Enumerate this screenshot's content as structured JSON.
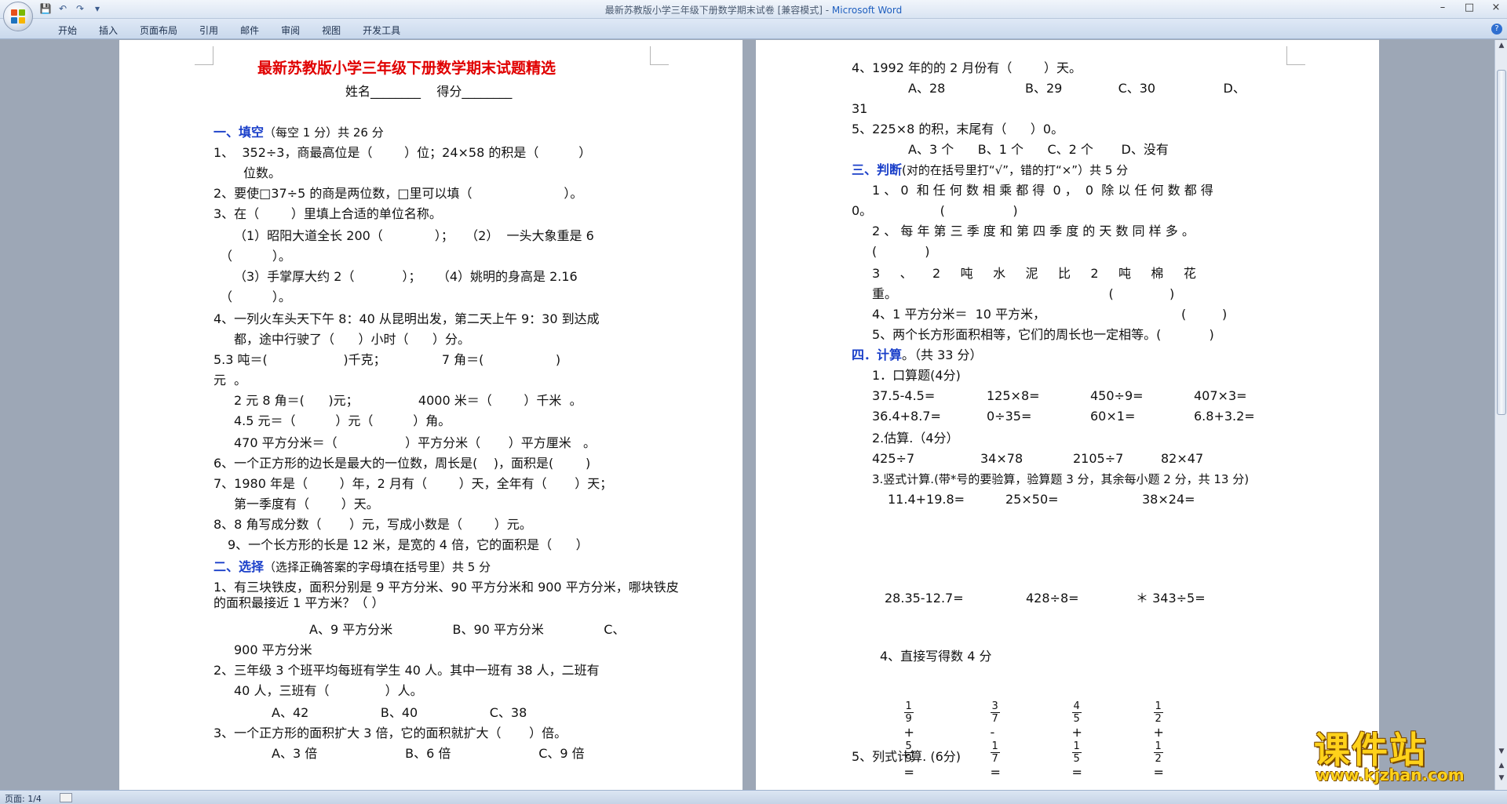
{
  "window": {
    "title": "最新苏教版小学三年级下册数学期末试卷 [兼容模式] - ",
    "app_name": "Microsoft Word",
    "controls": [
      "–",
      "□",
      "×"
    ]
  },
  "ribbon": {
    "tabs": [
      "开始",
      "插入",
      "页面布局",
      "引用",
      "邮件",
      "审阅",
      "视图",
      "开发工具"
    ]
  },
  "status": {
    "page": "页面: 1/4"
  },
  "watermark": {
    "name": "课件站",
    "url": "www.kjzhan.com"
  },
  "page1": {
    "title": "最新苏教版小学三年级下册数学期末试题精选",
    "lines": [
      "姓名________    得分________",
      "一、填空",
      "（每空 1 分）共 26 分",
      "1、  352÷3，商最高位是（        ）位；24×58 的积是（          ）",
      "位数。",
      "2、要使□37÷5 的商是两位数，□里可以填（                       ）。",
      "3、在（        ）里填上合适的单位名称。",
      "（1）昭阳大道全长 200（             ）；   （2）  一头大象重是 6",
      "（          ）。",
      "（3）手掌厚大约 2（            ）；    （4）姚明的身高是 2.16",
      "（          ）。",
      "4、一列火车头天下午 8：40 从昆明出发，第二天上午 9：30 到达成",
      "都，途中行驶了（      ）小时（      ）分。",
      "5.3 吨＝(                   )千克；              7 角＝(                  )",
      "元  。",
      "2 元 8 角＝(      )元；               4000 米＝（        ）千米  。",
      "4.5 元＝（          ）元（          ）角。",
      "470 平方分米＝（                 ）平方分米（       ）平方厘米   。",
      "6、一个正方形的边长是最大的一位数，周长是(    )，面积是(        )",
      "7、1980 年是（        ）年，2 月有（        ）天，全年有（       ）天；",
      "第一季度有（        ）天。",
      "8、8 角写成分数（       ）元，写成小数是（        ）元。",
      "9、一个长方形的长是 12 米，是宽的 4 倍，它的面积是（      ）",
      "二、选择",
      "（选择正确答案的字母填在括号里）共 5 分",
      "1、有三块铁皮，面积分别是 9 平方分米、90 平方分米和 900 平方分米，哪块铁皮的面积最接近 1 平方米？（               ）",
      "A、9 平方分米               B、90 平方分米               C、",
      "900 平方分米",
      "2、三年级 3 个班平均每班有学生 40 人。其中一班有 38 人，二班有",
      "40 人，三班有（              ）人。",
      "A、42                  B、40                  C、38",
      "3、一个正方形的面积扩大 3 倍，它的面积就扩大（       ）倍。",
      "A、3 倍                      B、6 倍                      C、9 倍"
    ]
  },
  "page2": {
    "lines": [
      "4、1992 年的的 2 月份有（        ）天。",
      "A、28                    B、29              C、30                 D、",
      "31",
      "5、225×8 的积，末尾有（      ）0。",
      "A、3 个      B、1 个      C、2 个       D、没有",
      "三、判断",
      "(对的在括号里打“√”，错的打“×”）共 5 分",
      "1 、 0  和 任 何 数 相 乘 都 得  0 ，  0  除 以 任 何 数 都 得",
      "0。                 (                 )",
      "2 、 每 年 第 三 季 度 和 第 四 季 度 的 天 数 同 样 多 。",
      "(            )",
      "3     、     2     吨     水     泥     比     2     吨     棉     花",
      "重。                                                     (              )",
      "4、1 平方分米＝  10 平方米，                                  (         )",
      "5、两个长方形面积相等，它们的周长也一定相等。(            )",
      "四．计算",
      "。（共 33 分）",
      "1．口算题(4分)",
      "37.5-4.5=",
      "125×8=",
      "450÷9=",
      "407×3=",
      "36.4+8.7=",
      "0÷35=",
      "60×1=",
      "6.8+3.2=",
      "2.估算.（4分）",
      "425÷7",
      "34×78",
      "2105÷7",
      "82×47",
      "3.竖式计算.(带*号的要验算，验算题 3 分，其余每小题 2 分，共 13 分)",
      "11.4+19.8=",
      "25×50=",
      "38×24=",
      "28.35-12.7=",
      "428÷8=",
      "＊ 343÷5=",
      "4、直接写得数 4 分",
      "5、列式计算. (6分)"
    ],
    "fractions": [
      {
        "a_num": "1",
        "a_den": "9",
        "op": "+",
        "b_num": "5",
        "b_den": "9"
      },
      {
        "a_num": "3",
        "a_den": "7",
        "op": "-",
        "b_num": "1",
        "b_den": "7"
      },
      {
        "a_num": "4",
        "a_den": "5",
        "op": "+",
        "b_num": "1",
        "b_den": "5"
      },
      {
        "a_num": "1",
        "a_den": "2",
        "op": "+",
        "b_num": "1",
        "b_den": "2"
      }
    ],
    "equals": "="
  }
}
